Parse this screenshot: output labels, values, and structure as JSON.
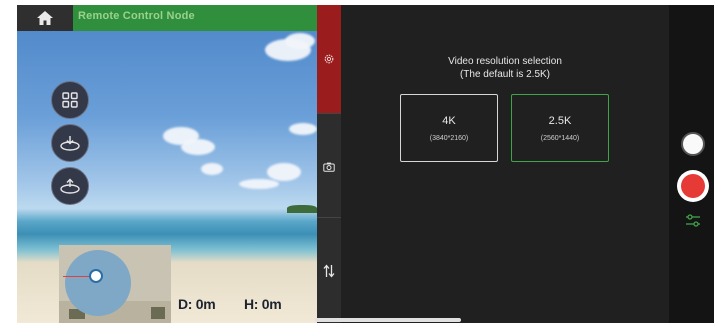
{
  "header": {
    "title": "Remote Control Node"
  },
  "icons": {
    "home": "home-icon",
    "settings": "gear-icon",
    "camera": "camera-icon",
    "transfer": "up-down-arrows-icon",
    "grid": "grid-icon",
    "landing": "landing-icon",
    "takeoff": "takeoff-icon",
    "adjust": "sliders-icon"
  },
  "telemetry": {
    "distance": "D: 0m",
    "height": "H: 0m"
  },
  "resolution": {
    "title_line1": "Video resolution selection",
    "title_line2": "(The default is 2.5K)",
    "options": [
      {
        "label": "4K",
        "sub": "(3840*2160)",
        "selected": false
      },
      {
        "label": "2.5K",
        "sub": "(2560*1440)",
        "selected": true
      }
    ]
  },
  "colors": {
    "accent": "#3fa34a",
    "record": "#e63a36",
    "settings_tab": "#9b1c1c",
    "title_bar": "#2f8f3c"
  }
}
